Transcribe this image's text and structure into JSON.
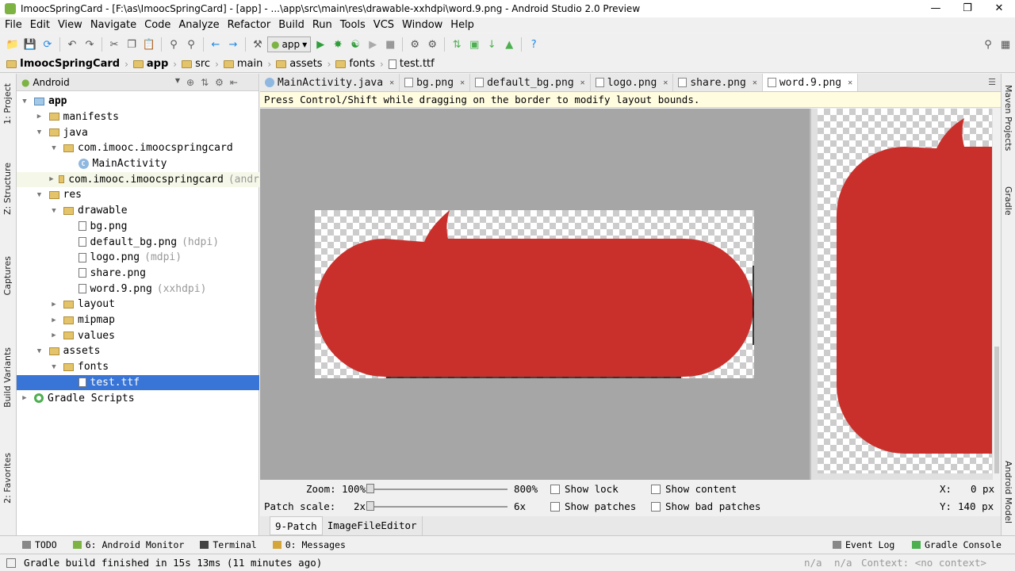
{
  "window": {
    "title": "ImoocSpringCard - [F:\\as\\ImoocSpringCard] - [app] - ...\\app\\src\\main\\res\\drawable-xxhdpi\\word.9.png - Android Studio 2.0 Preview",
    "minimize": "—",
    "maximize": "❐",
    "close": "✕"
  },
  "menu": [
    "File",
    "Edit",
    "View",
    "Navigate",
    "Code",
    "Analyze",
    "Refactor",
    "Build",
    "Run",
    "Tools",
    "VCS",
    "Window",
    "Help"
  ],
  "toolbar": {
    "run_config": "app",
    "search_icon": "magnifier-icon"
  },
  "breadcrumb": [
    "ImoocSpringCard",
    "app",
    "src",
    "main",
    "assets",
    "fonts",
    "test.ttf"
  ],
  "left_tool_tabs": [
    "1: Project",
    "Z: Structure",
    "Captures",
    "Build Variants",
    "2: Favorites"
  ],
  "right_tool_tabs": [
    "Maven Projects",
    "Gradle",
    "Android Model"
  ],
  "project_panel": {
    "view": "Android",
    "tree": [
      {
        "label": "app",
        "note": "",
        "level": 0,
        "expanded": true,
        "icon": "module"
      },
      {
        "label": "manifests",
        "note": "",
        "level": 1,
        "expanded": false,
        "icon": "folder"
      },
      {
        "label": "java",
        "note": "",
        "level": 1,
        "expanded": true,
        "icon": "folder"
      },
      {
        "label": "com.imooc.imoocspringcard",
        "note": "",
        "level": 2,
        "expanded": true,
        "icon": "package"
      },
      {
        "label": "MainActivity",
        "note": "",
        "level": 3,
        "expanded": null,
        "icon": "class"
      },
      {
        "label": "com.imooc.imoocspringcard",
        "note": "(andr",
        "level": 2,
        "expanded": false,
        "icon": "package"
      },
      {
        "label": "res",
        "note": "",
        "level": 1,
        "expanded": true,
        "icon": "folder"
      },
      {
        "label": "drawable",
        "note": "",
        "level": 2,
        "expanded": true,
        "icon": "folder"
      },
      {
        "label": "bg.png",
        "note": "",
        "level": 3,
        "expanded": null,
        "icon": "file"
      },
      {
        "label": "default_bg.png",
        "note": "(hdpi)",
        "level": 3,
        "expanded": null,
        "icon": "file"
      },
      {
        "label": "logo.png",
        "note": "(mdpi)",
        "level": 3,
        "expanded": null,
        "icon": "file"
      },
      {
        "label": "share.png",
        "note": "",
        "level": 3,
        "expanded": null,
        "icon": "file"
      },
      {
        "label": "word.9.png",
        "note": "(xxhdpi)",
        "level": 3,
        "expanded": null,
        "icon": "file"
      },
      {
        "label": "layout",
        "note": "",
        "level": 2,
        "expanded": false,
        "icon": "folder"
      },
      {
        "label": "mipmap",
        "note": "",
        "level": 2,
        "expanded": false,
        "icon": "folder"
      },
      {
        "label": "values",
        "note": "",
        "level": 2,
        "expanded": false,
        "icon": "folder"
      },
      {
        "label": "assets",
        "note": "",
        "level": 1,
        "expanded": true,
        "icon": "folder"
      },
      {
        "label": "fonts",
        "note": "",
        "level": 2,
        "expanded": true,
        "icon": "folder"
      },
      {
        "label": "test.ttf",
        "note": "",
        "level": 3,
        "expanded": null,
        "icon": "file",
        "selected": true
      },
      {
        "label": "Gradle Scripts",
        "note": "",
        "level": 0,
        "expanded": false,
        "icon": "gradle"
      }
    ]
  },
  "editor_tabs": [
    {
      "label": "MainActivity.java",
      "active": false
    },
    {
      "label": "bg.png",
      "active": false
    },
    {
      "label": "default_bg.png",
      "active": false
    },
    {
      "label": "logo.png",
      "active": false
    },
    {
      "label": "share.png",
      "active": false
    },
    {
      "label": "word.9.png",
      "active": true
    }
  ],
  "hint": "Press Control/Shift while dragging on the border to modify layout bounds.",
  "ninepatch": {
    "fill_color": "#c9302c",
    "zoom_label": "Zoom:",
    "zoom_min": "100%",
    "zoom_max": "800%",
    "zoom_value": 0.0,
    "patch_scale_label": "Patch scale:",
    "scale_min": "2x",
    "scale_max": "6x",
    "scale_value": 0.0,
    "show_lock": "Show lock",
    "show_patches": "Show patches",
    "show_content": "Show content",
    "show_bad_patches": "Show bad patches",
    "x_label": "X:",
    "x_value": "0 px",
    "y_label": "Y:",
    "y_value": "140 px"
  },
  "bottom_tabs": [
    "9-Patch",
    "ImageFileEditor"
  ],
  "tool_windows": {
    "todo": "TODO",
    "monitor": "6: Android Monitor",
    "terminal": "Terminal",
    "messages": "0: Messages",
    "event_log": "Event Log",
    "gradle_console": "Gradle Console"
  },
  "status": {
    "message": "Gradle build finished in 15s 13ms (11 minutes ago)",
    "na1": "n/a",
    "na2": "n/a",
    "context": "Context: <no context>"
  }
}
